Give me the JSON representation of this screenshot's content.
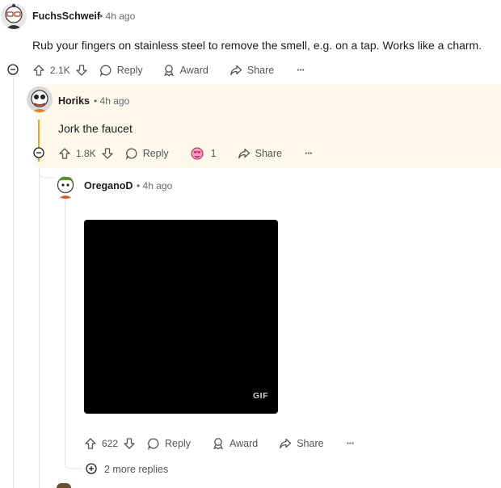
{
  "comments": [
    {
      "username": "FuchsSchweif",
      "time": "4h ago",
      "body": "Rub your fingers on stainless steel to remove the smell, e.g. on a tap. Works like a charm.",
      "score": "2.1K",
      "actions": {
        "reply": "Reply",
        "award": "Award",
        "share": "Share",
        "more": "···"
      }
    },
    {
      "username": "Horiks",
      "time": "4h ago",
      "body": "Jork the faucet",
      "score": "1.8K",
      "award_count": "1",
      "actions": {
        "reply": "Reply",
        "share": "Share",
        "more": "···"
      }
    },
    {
      "username": "OreganoD",
      "time": "4h ago",
      "gif_label": "GIF",
      "score": "622",
      "actions": {
        "reply": "Reply",
        "award": "Award",
        "share": "Share",
        "more": "···"
      }
    }
  ],
  "more_replies": "2 more replies",
  "separator": "•",
  "colors": {
    "highlight_bg": "#fdf8e9",
    "highlight_bar": "#d7a940",
    "thread": "#e5e5e5"
  }
}
